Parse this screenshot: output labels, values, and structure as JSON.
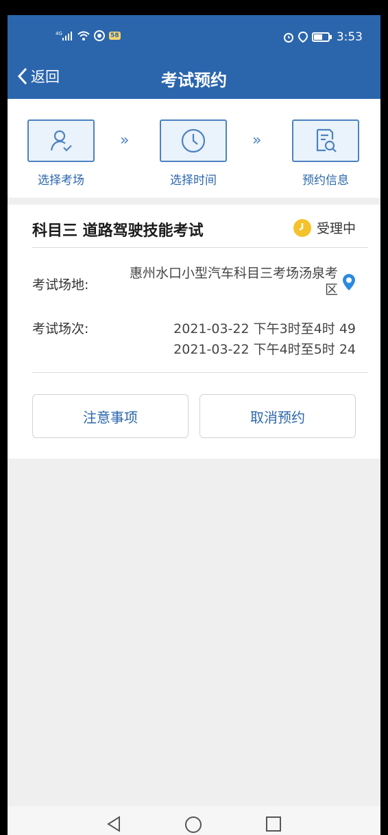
{
  "status_bar": {
    "time": "3:53",
    "badge": "58"
  },
  "header": {
    "back_label": "返回",
    "title": "考试预约"
  },
  "steps": [
    {
      "label": "选择考场",
      "icon": "user-check-icon"
    },
    {
      "label": "选择时间",
      "icon": "clock-icon"
    },
    {
      "label": "预约信息",
      "icon": "document-search-icon"
    }
  ],
  "step_arrow": "»",
  "exam": {
    "title": "科目三 道路驾驶技能考试",
    "status": "受理中",
    "venue_label": "考试场地:",
    "venue_line1": "惠州水口小型汽车科目三考场汤泉考",
    "venue_line2": "区",
    "session_label": "考试场次:",
    "sessions": [
      "2021-03-22 下午3时至4时 49",
      "2021-03-22 下午4时至5时 24"
    ]
  },
  "buttons": {
    "notice": "注意事项",
    "cancel": "取消预约"
  },
  "colors": {
    "primary": "#2b66ad",
    "status_yellow": "#f5c22b",
    "location_blue": "#2a8be0"
  }
}
